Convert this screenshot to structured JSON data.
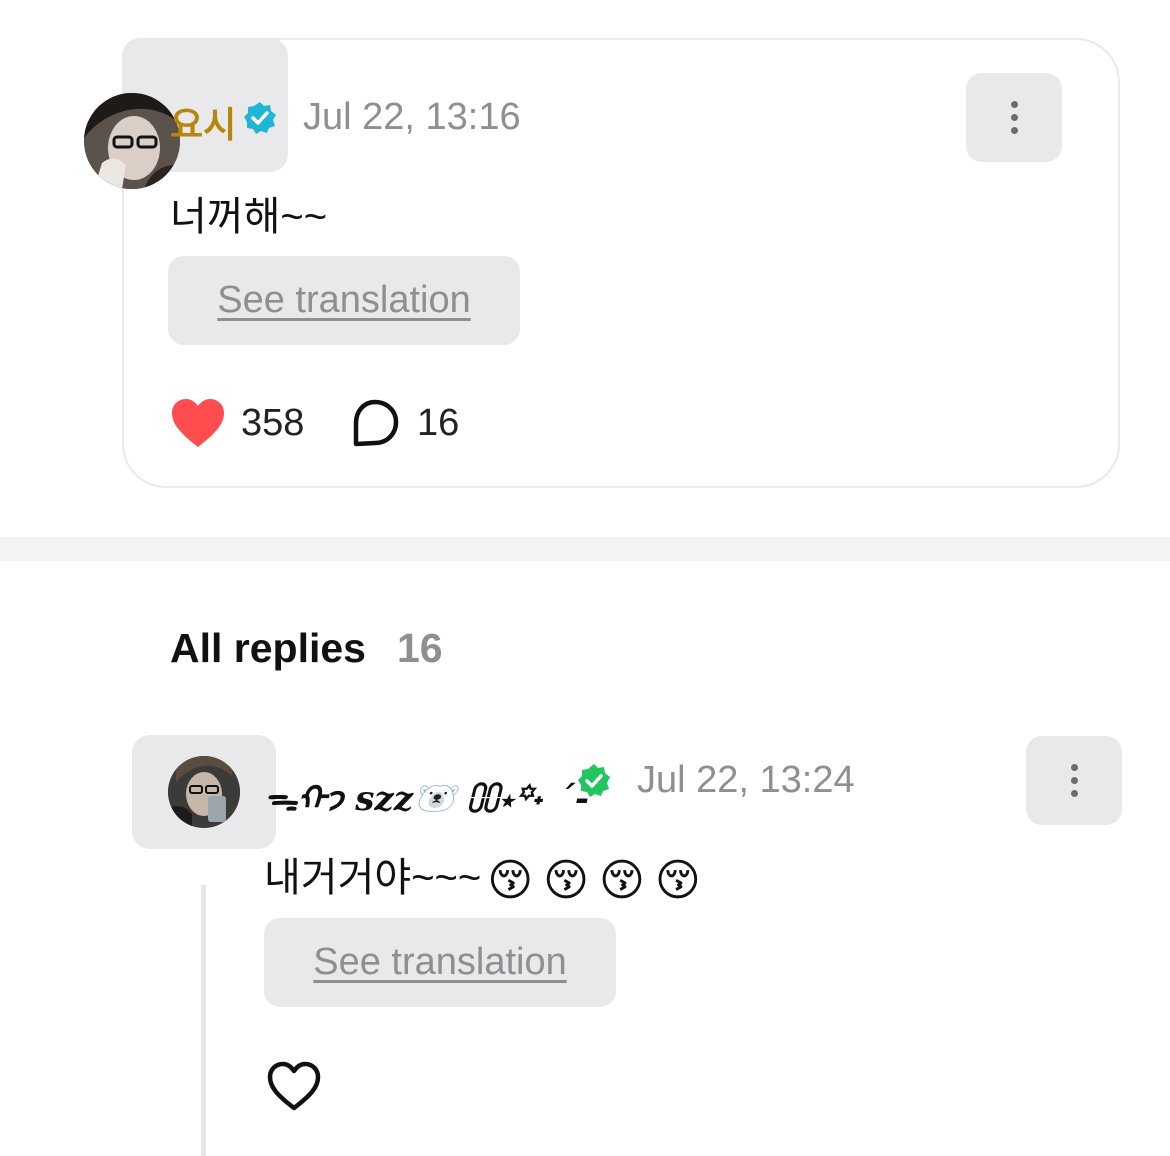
{
  "post": {
    "username": "요시",
    "timestamp": "Jul 22, 13:16",
    "text": "너꺼해~~",
    "translate_label": "See translation",
    "likes": "358",
    "comments": "16",
    "icons": [
      "verified-badge-icon",
      "more-options-icon",
      "heart-filled-icon",
      "comment-icon"
    ],
    "colors": {
      "username": "#b8860b",
      "verified": "#1fb6d6",
      "heart": "#ff4d4f"
    }
  },
  "replies_section": {
    "title": "All replies",
    "count": "16"
  },
  "reply": {
    "username": "ᯓᡣ𐭩 𝒔𝒛𝒛🐻‍❄️ ⩇⩇⋆꙳˖ ˊ-",
    "timestamp": "Jul 22, 13:24",
    "text": "내거거야~~~",
    "emojis": [
      "😚",
      "😚",
      "😚",
      "😚"
    ],
    "translate_label": "See translation",
    "icons": [
      "verified-badge-icon",
      "more-options-icon",
      "heart-outline-icon"
    ],
    "colors": {
      "verified": "#22c55e"
    }
  }
}
